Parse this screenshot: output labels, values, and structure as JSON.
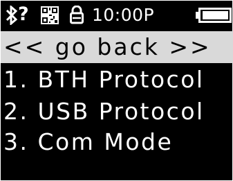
{
  "status_bar": {
    "icons": [
      "bluetooth-icon",
      "unknown-icon",
      "qr-code-icon",
      "lock-icon",
      "battery-icon"
    ],
    "unknown_symbol": "?",
    "time": "10:00P"
  },
  "menu": {
    "items": [
      {
        "label": "<< go  back >>",
        "selected": true
      },
      {
        "label": "1. BTH Protocol",
        "selected": false
      },
      {
        "label": "2. USB Protocol",
        "selected": false
      },
      {
        "label": "3. Com Mode",
        "selected": false
      }
    ]
  },
  "colors": {
    "background": "#000000",
    "text": "#ffffff",
    "selection": "#d9d9d9",
    "selected_text": "#000000"
  }
}
